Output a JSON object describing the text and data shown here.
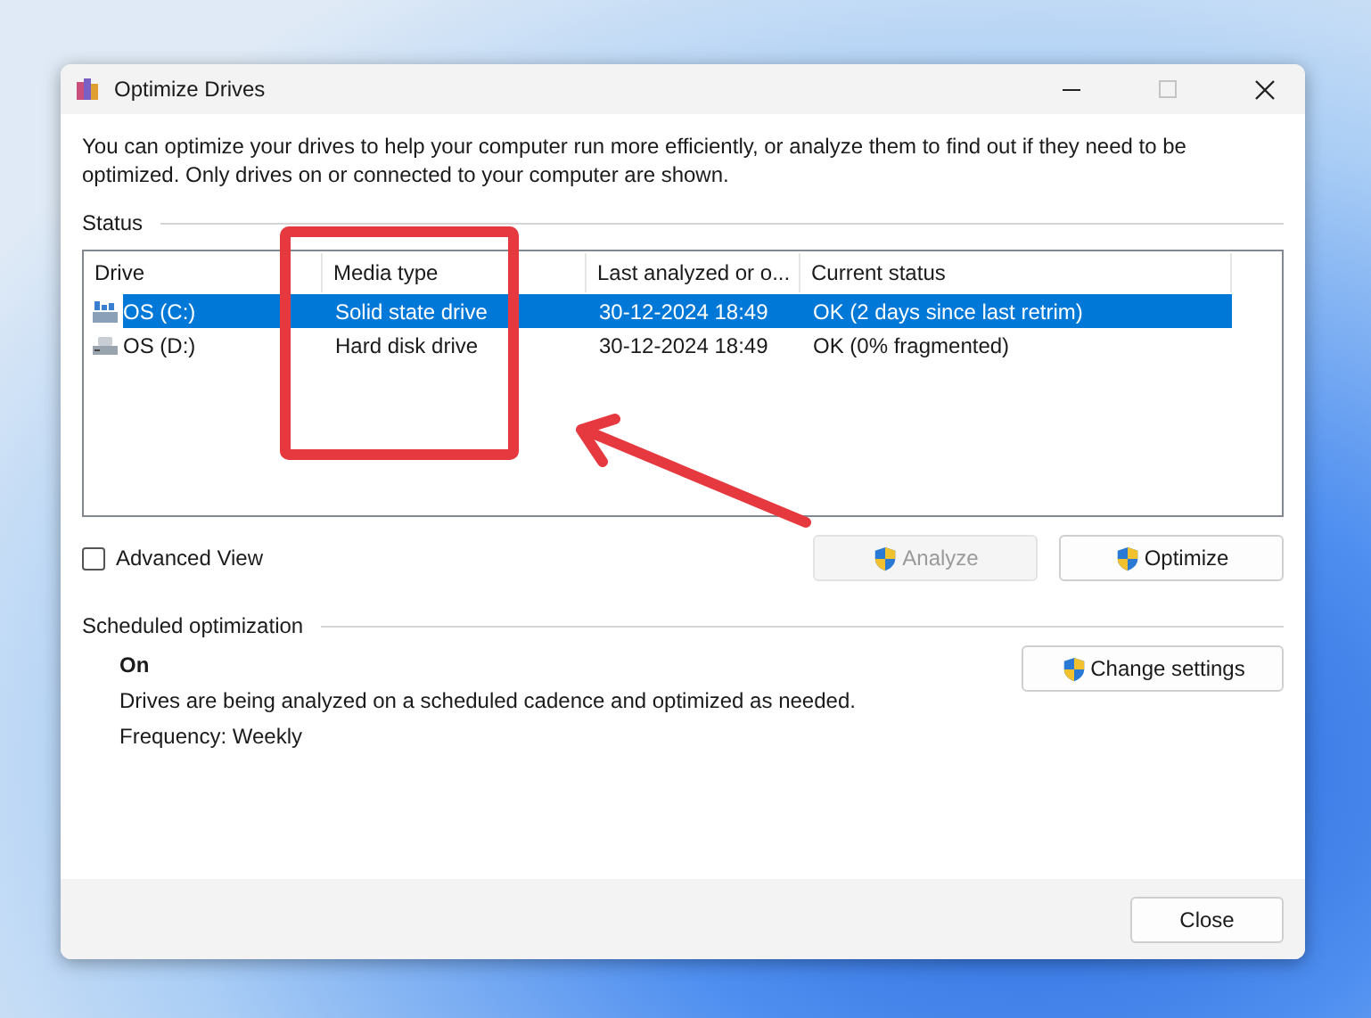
{
  "window": {
    "title": "Optimize Drives",
    "maximize_disabled": true
  },
  "description": "You can optimize your drives to help your computer run more efficiently, or analyze them to find out if they need to be optimized. Only drives on or connected to your computer are shown.",
  "status": {
    "heading": "Status",
    "columns": [
      "Drive",
      "Media type",
      "Last analyzed or o...",
      "Current status"
    ],
    "drives": [
      {
        "name": "OS (C:)",
        "kind": "ssd",
        "selected": true,
        "media_type": "Solid state drive",
        "last_analyzed": "30-12-2024 18:49",
        "current_status": "OK (2 days since last retrim)"
      },
      {
        "name": "OS (D:)",
        "kind": "hdd",
        "selected": false,
        "media_type": "Hard disk drive",
        "last_analyzed": "30-12-2024 18:49",
        "current_status": "OK (0% fragmented)"
      }
    ]
  },
  "advanced_view": {
    "label": "Advanced View",
    "checked": false
  },
  "actions": [
    {
      "label": "Analyze",
      "disabled": true
    },
    {
      "label": "Optimize",
      "disabled": false
    }
  ],
  "scheduled": {
    "heading": "Scheduled optimization",
    "state": "On",
    "description": "Drives are being analyzed on a scheduled cadence and optimized as needed.",
    "frequency": "Frequency: Weekly",
    "button": "Change settings"
  },
  "close_button": "Close"
}
